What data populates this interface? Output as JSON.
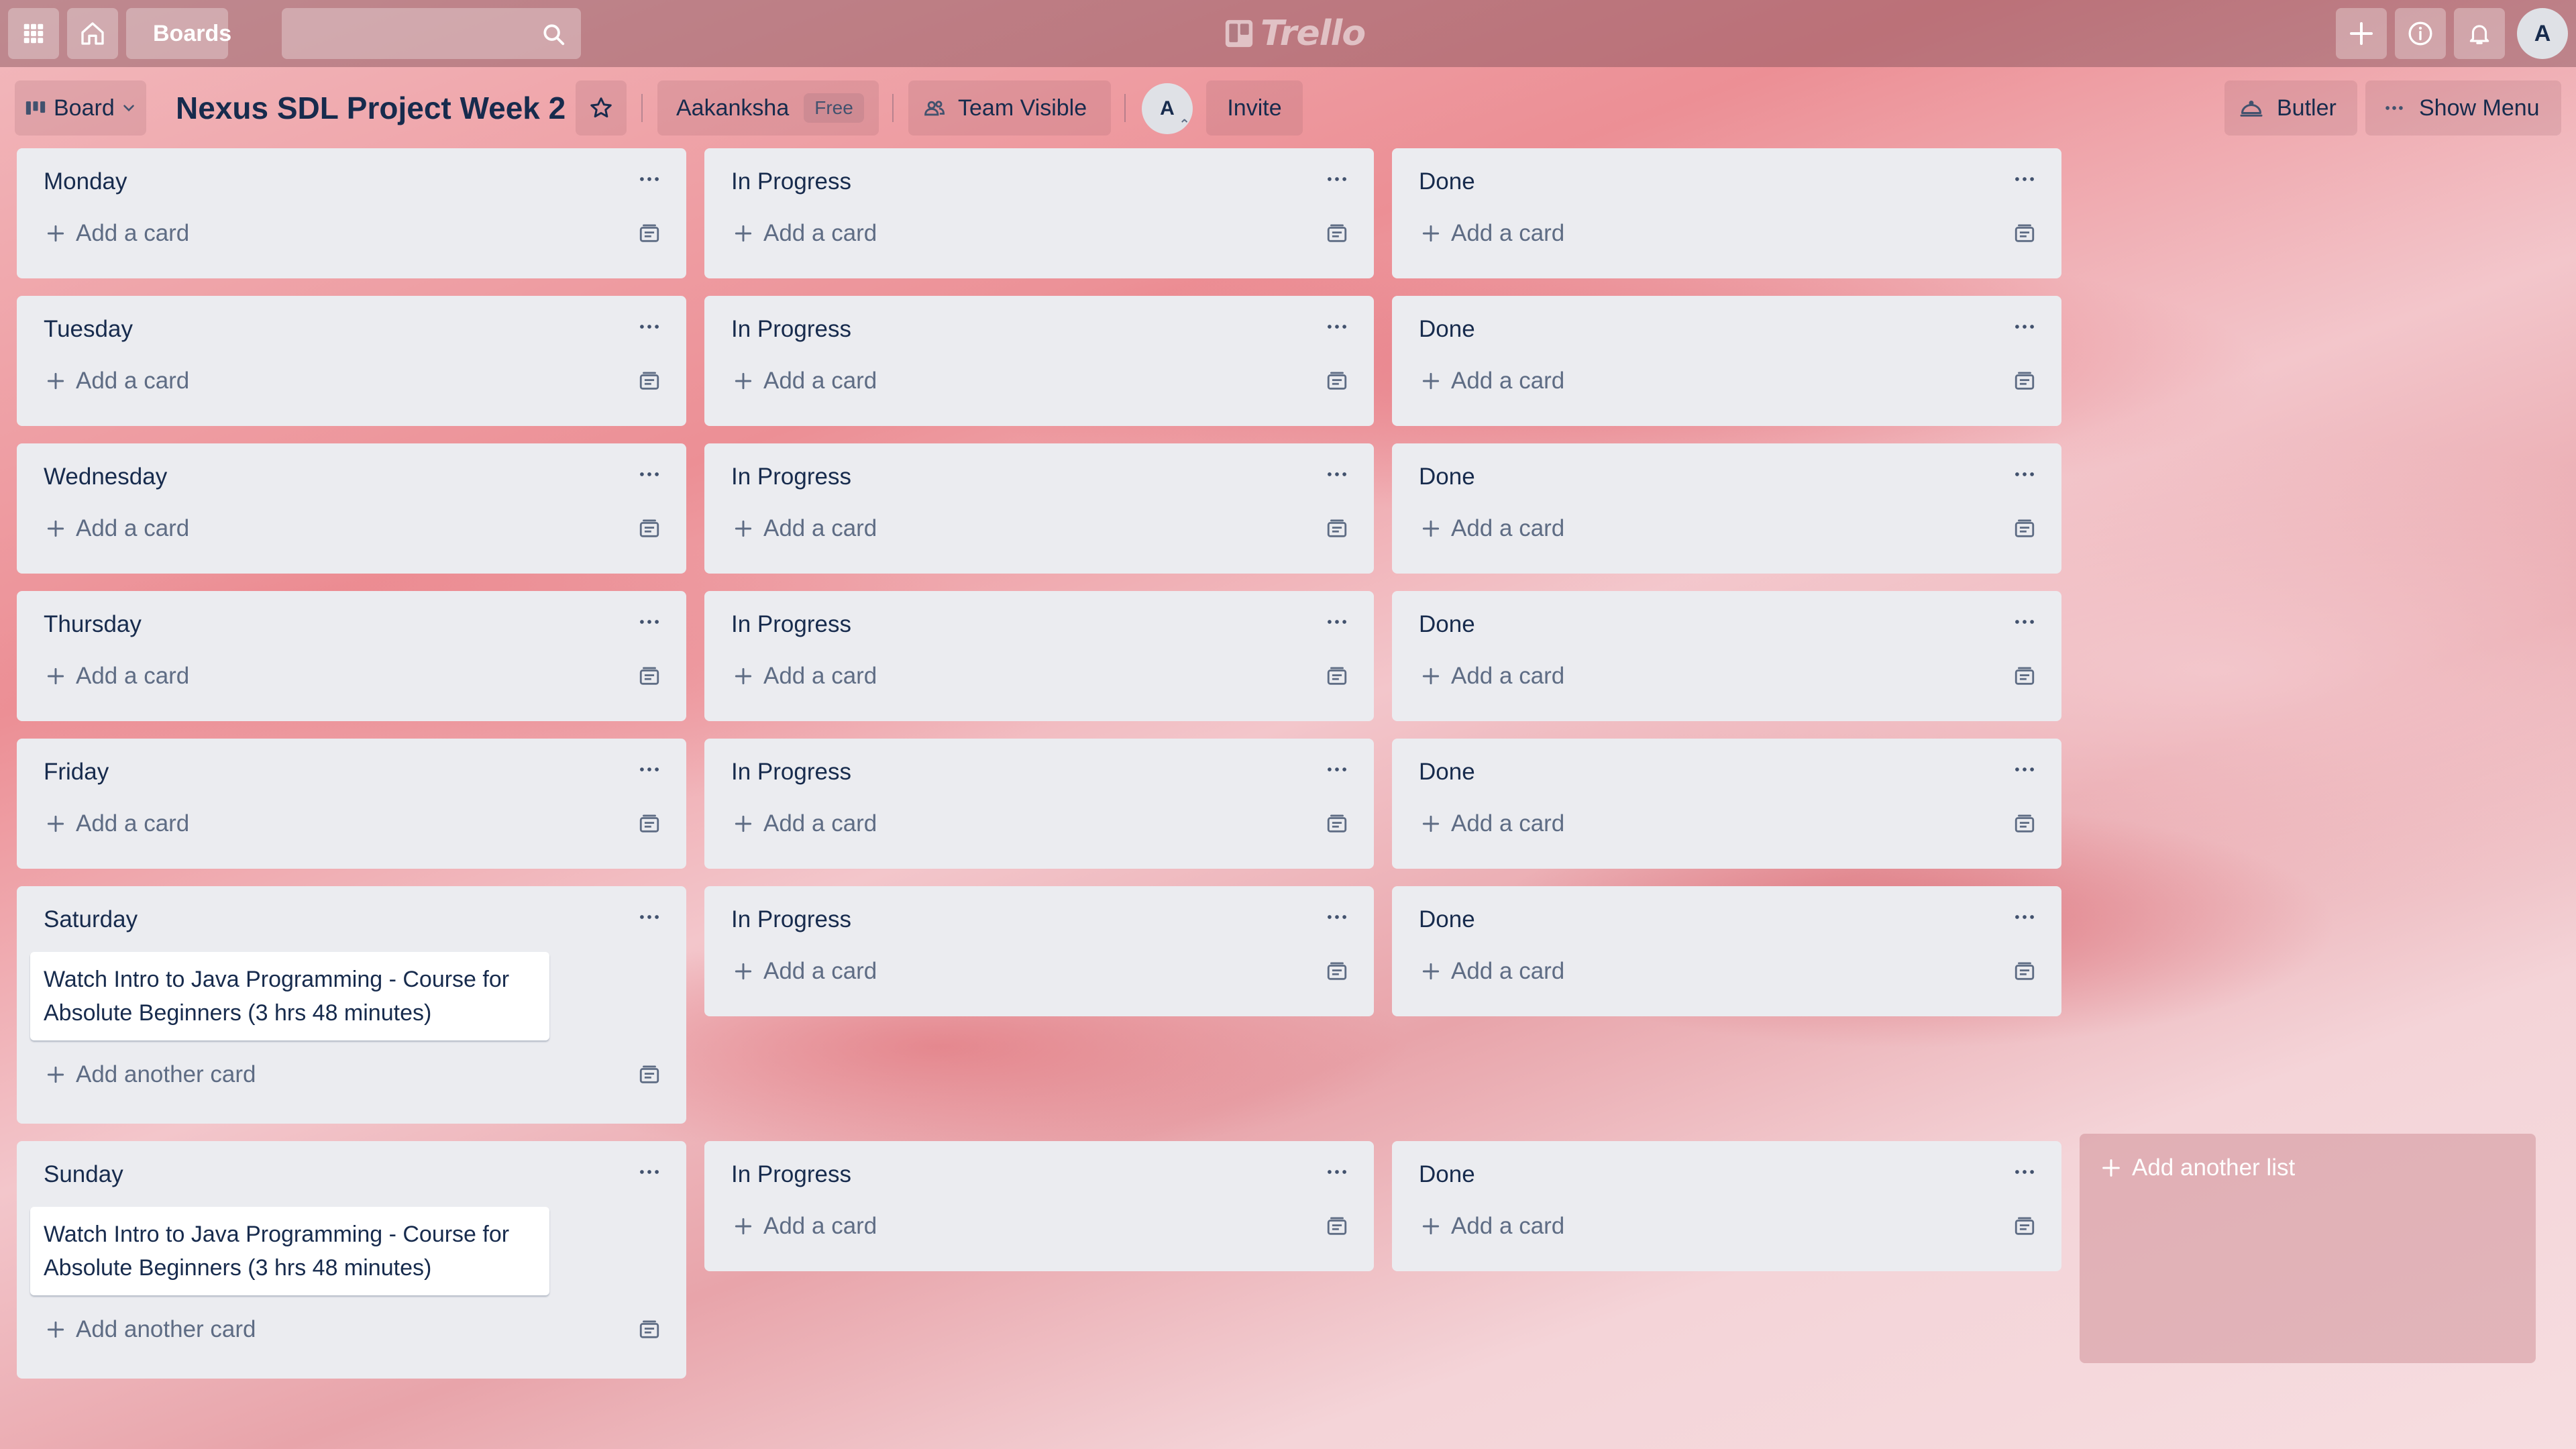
{
  "topbar": {
    "boards_label": "Boards",
    "logo_text": "Trello",
    "avatar_initial": "A",
    "icons": [
      "apps-grid-icon",
      "home-icon",
      "boards-icon",
      "search-icon",
      "plus-icon",
      "info-icon",
      "bell-icon"
    ]
  },
  "header": {
    "board_view_label": "Board",
    "title": "Nexus SDL Project Week 2",
    "team_name": "Aakanksha",
    "team_badge": "Free",
    "visibility_label": "Team Visible",
    "member_initial": "A",
    "invite_label": "Invite",
    "butler_label": "Butler",
    "show_menu_label": "Show Menu"
  },
  "add_card_label": "Add a card",
  "add_another_card_label": "Add another card",
  "add_another_list_label": "Add another list",
  "lists": [
    {
      "title": "Monday"
    },
    {
      "title": "In Progress"
    },
    {
      "title": "Done"
    },
    {
      "title": "Tuesday"
    },
    {
      "title": "In Progress"
    },
    {
      "title": "Done"
    },
    {
      "title": "Wednesday"
    },
    {
      "title": "In Progress"
    },
    {
      "title": "Done"
    },
    {
      "title": "Thursday"
    },
    {
      "title": "In Progress"
    },
    {
      "title": "Done"
    },
    {
      "title": "Friday"
    },
    {
      "title": "In Progress"
    },
    {
      "title": "Done"
    },
    {
      "title": "Saturday",
      "cards": [
        "Watch Intro to Java Programming - Course for Absolute Beginners (3 hrs 48 minutes)"
      ]
    },
    {
      "title": "In Progress"
    },
    {
      "title": "Done"
    },
    {
      "title": "Sunday",
      "cards": [
        "Watch Intro to Java Programming - Course for Absolute Beginners (3 hrs 48 minutes)"
      ]
    },
    {
      "title": "In Progress"
    },
    {
      "title": "Done"
    }
  ],
  "colors": {
    "list_bg": "#ebecf0",
    "text": "#172b4d",
    "muted_text": "#5e6c84",
    "topbar": "#9c6670"
  }
}
